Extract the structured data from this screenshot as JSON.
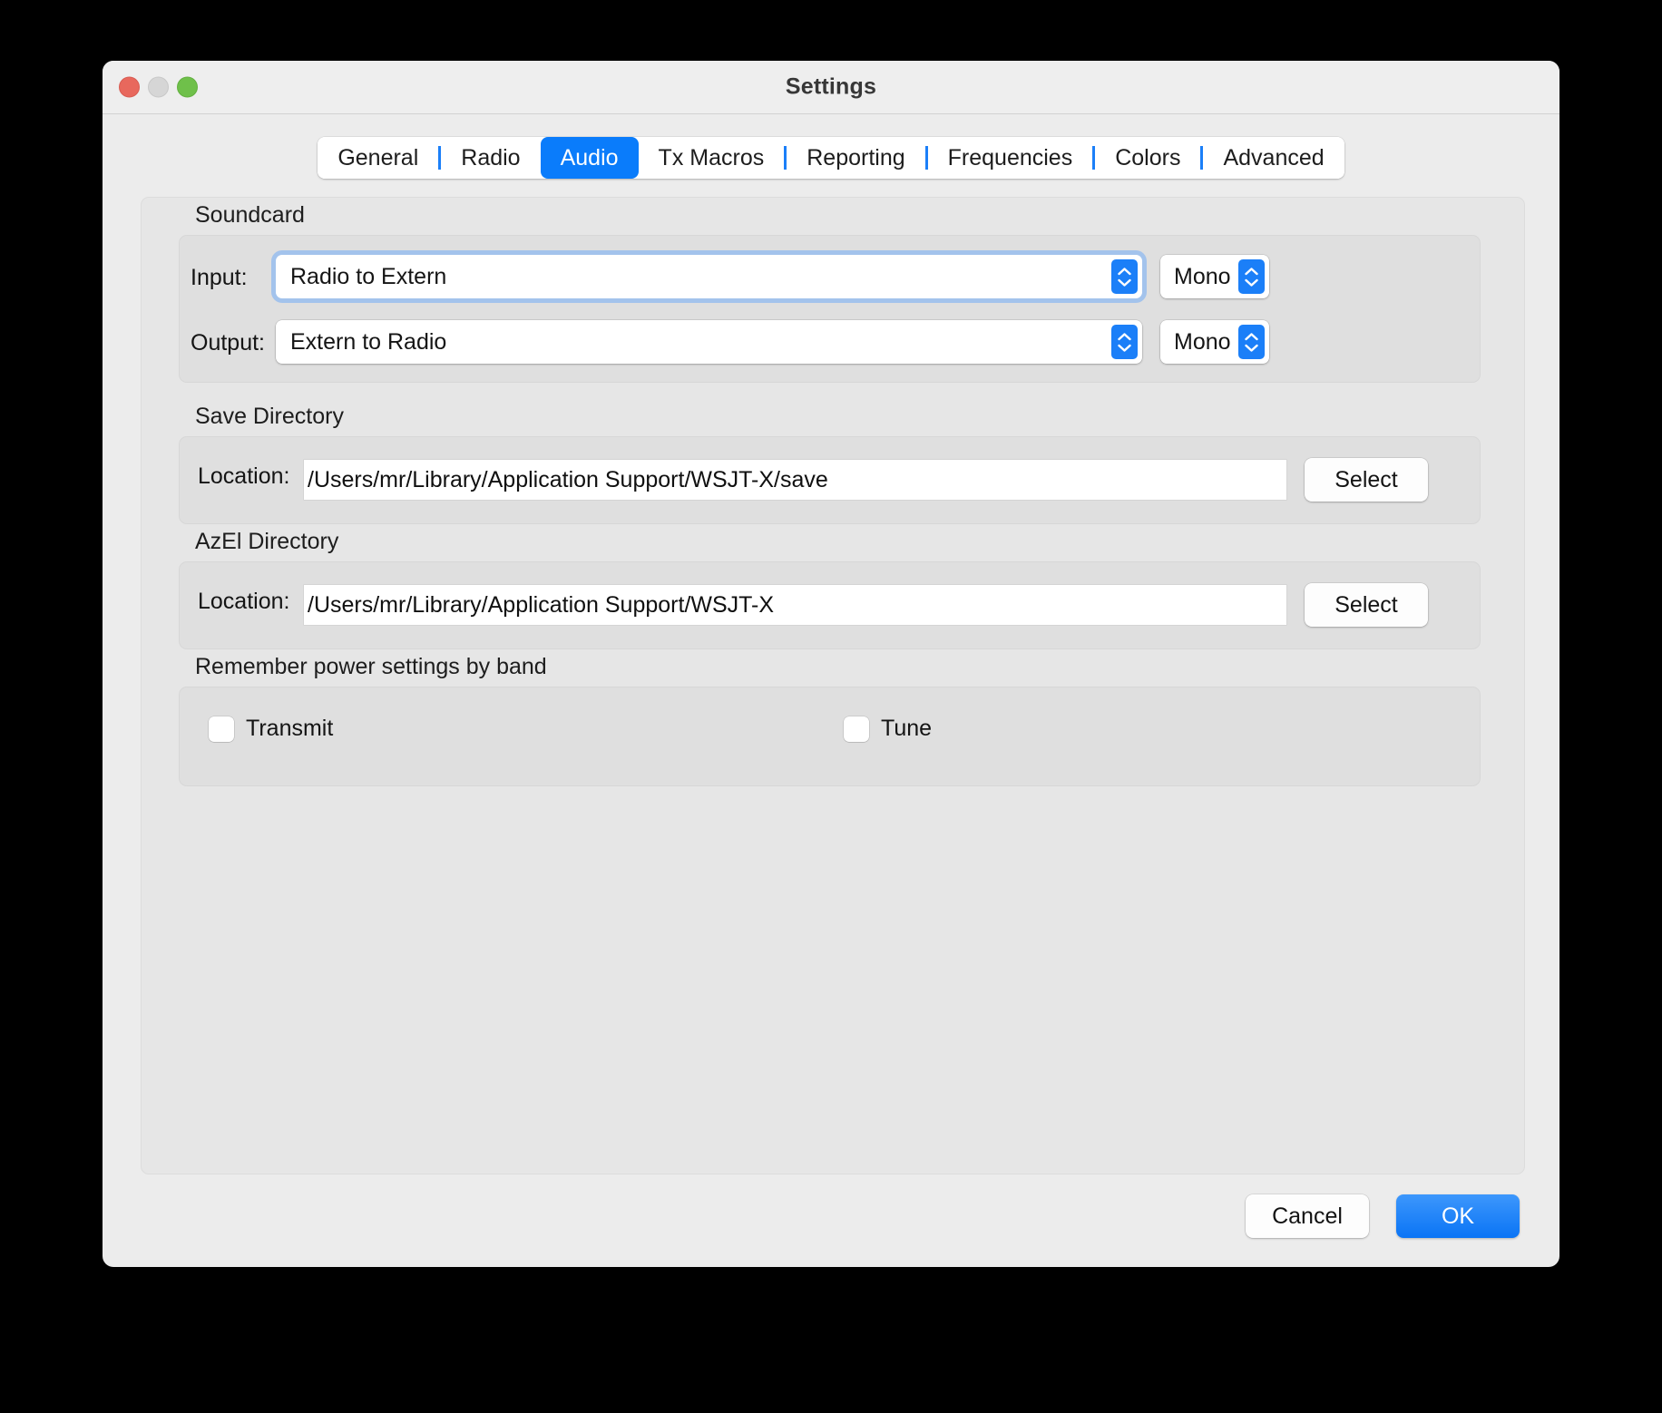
{
  "window": {
    "title": "Settings",
    "traffic_lights": [
      "close",
      "minimize",
      "zoom"
    ]
  },
  "tabs": [
    {
      "label": "General",
      "selected": false
    },
    {
      "label": "Radio",
      "selected": false
    },
    {
      "label": "Audio",
      "selected": true
    },
    {
      "label": "Tx Macros",
      "selected": false
    },
    {
      "label": "Reporting",
      "selected": false
    },
    {
      "label": "Frequencies",
      "selected": false
    },
    {
      "label": "Colors",
      "selected": false
    },
    {
      "label": "Advanced",
      "selected": false
    }
  ],
  "soundcard": {
    "title": "Soundcard",
    "input": {
      "label": "Input:",
      "device": "Radio to Extern",
      "channel": "Mono"
    },
    "output": {
      "label": "Output:",
      "device": "Extern to Radio",
      "channel": "Mono"
    }
  },
  "save_directory": {
    "title": "Save Directory",
    "label": "Location:",
    "path": "/Users/mr/Library/Application Support/WSJT-X/save",
    "select_label": "Select"
  },
  "azel_directory": {
    "title": "AzEl Directory",
    "label": "Location:",
    "path": "/Users/mr/Library/Application Support/WSJT-X",
    "select_label": "Select"
  },
  "power_settings": {
    "title": "Remember power settings by band",
    "transmit": {
      "label": "Transmit",
      "checked": false
    },
    "tune": {
      "label": "Tune",
      "checked": false
    }
  },
  "footer": {
    "cancel_label": "Cancel",
    "ok_label": "OK"
  },
  "colors": {
    "accent": "#0a7cfb",
    "window_bg": "#ececec",
    "panel_bg": "#e6e6e6",
    "group_bg": "#dfdfdf",
    "focus_ring": "#a3c3ec",
    "traffic_close": "#e8685d",
    "traffic_min": "#d6d6d6",
    "traffic_zoom": "#6fc04a"
  }
}
